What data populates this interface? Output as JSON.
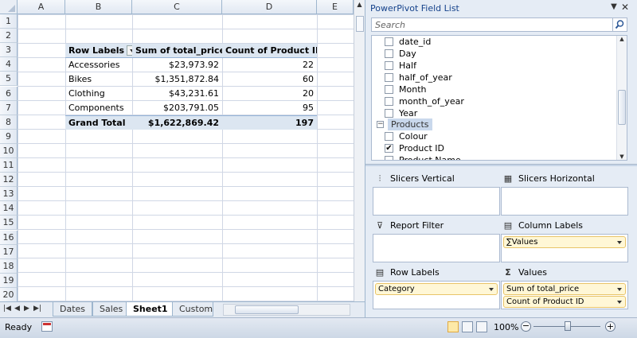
{
  "columns": [
    "A",
    "B",
    "C",
    "D",
    "E"
  ],
  "rows": [
    "1",
    "2",
    "3",
    "4",
    "5",
    "6",
    "7",
    "8",
    "9",
    "10",
    "11",
    "12",
    "13",
    "14",
    "15",
    "16",
    "17",
    "18",
    "19",
    "20"
  ],
  "pivot": {
    "headers": [
      "Row Labels",
      "Sum of total_price",
      "Count of Product ID"
    ],
    "data": [
      {
        "label": "Accessories",
        "price": "$23,973.92",
        "count": "22"
      },
      {
        "label": "Bikes",
        "price": "$1,351,872.84",
        "count": "60"
      },
      {
        "label": "Clothing",
        "price": "$43,231.61",
        "count": "20"
      },
      {
        "label": "Components",
        "price": "$203,791.05",
        "count": "95"
      }
    ],
    "total": {
      "label": "Grand Total",
      "price": "$1,622,869.42",
      "count": "197"
    }
  },
  "sheet_tabs": [
    "Dates",
    "Sales",
    "Sheet1",
    "Custome"
  ],
  "active_tab": "Sheet1",
  "status": {
    "ready": "Ready",
    "zoom": "100%"
  },
  "panel": {
    "title": "PowerPivot Field List",
    "search_placeholder": "Search",
    "fields": [
      {
        "label": "date_id",
        "checked": false
      },
      {
        "label": "Day",
        "checked": false
      },
      {
        "label": "Half",
        "checked": false
      },
      {
        "label": "half_of_year",
        "checked": false
      },
      {
        "label": "Month",
        "checked": false
      },
      {
        "label": "month_of_year",
        "checked": false
      },
      {
        "label": "Year",
        "checked": false
      }
    ],
    "group": "Products",
    "group_fields": [
      {
        "label": "Colour",
        "checked": false
      },
      {
        "label": "Product ID",
        "checked": true
      },
      {
        "label": "Product Name",
        "checked": false
      }
    ],
    "zones": {
      "slicers_vertical": "Slicers Vertical",
      "slicers_horizontal": "Slicers Horizontal",
      "report_filter": "Report Filter",
      "column_labels": "Column Labels",
      "row_labels": "Row Labels",
      "values": "Values",
      "column_items": [
        "∑Values"
      ],
      "row_items": [
        "Category"
      ],
      "value_items": [
        "Sum of total_price",
        "Count of Product ID"
      ]
    }
  }
}
